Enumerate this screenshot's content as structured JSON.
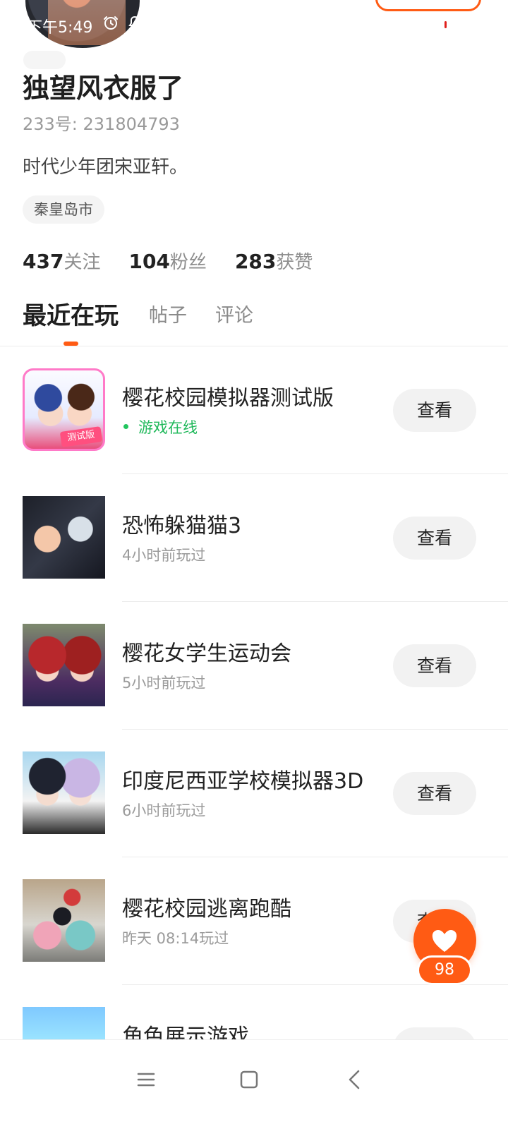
{
  "status_bar": {
    "time": "下午5:49",
    "icons": [
      "alarm-icon",
      "app-notification-icon"
    ]
  },
  "profile": {
    "username": "独望风衣服了",
    "id_text": "233号: 231804793",
    "bio": "时代少年团宋亚轩。",
    "location": "秦皇岛市",
    "stats": [
      {
        "value": "437",
        "label": "关注"
      },
      {
        "value": "104",
        "label": "粉丝"
      },
      {
        "value": "283",
        "label": "获赞"
      }
    ]
  },
  "tabs": [
    {
      "label": "最近在玩",
      "active": true
    },
    {
      "label": "帖子",
      "active": false
    },
    {
      "label": "评论",
      "active": false
    }
  ],
  "games": [
    {
      "title": "樱花校园模拟器测试版",
      "subtitle": "游戏在线",
      "status": "online",
      "button": "查看",
      "icon": "sakura-school-test-icon",
      "badge": "测试版"
    },
    {
      "title": "恐怖躲猫猫3",
      "subtitle": "4小时前玩过",
      "status": "played",
      "button": "查看",
      "icon": "horror-hide-and-seek-icon"
    },
    {
      "title": "樱花女学生运动会",
      "subtitle": "5小时前玩过",
      "status": "played",
      "button": "查看",
      "icon": "sakura-girls-sports-icon"
    },
    {
      "title": "印度尼西亚学校模拟器3D",
      "subtitle": "6小时前玩过",
      "status": "played",
      "button": "查看",
      "icon": "indonesia-school-sim-icon"
    },
    {
      "title": "樱花校园逃离跑酷",
      "subtitle": "昨天 08:14玩过",
      "status": "played",
      "button": "查看",
      "icon": "sakura-escape-parkour-icon"
    },
    {
      "title": "角色展示游戏",
      "subtitle": "",
      "status": "partial",
      "button": "",
      "icon": "character-show-game-icon"
    }
  ],
  "like_button": {
    "count": "98",
    "icon": "heart-icon"
  },
  "navigation": {
    "icons": [
      "menu-icon",
      "home-icon",
      "back-icon"
    ]
  },
  "colors": {
    "accent": "#ff5b14",
    "online": "#1fb85a",
    "secondary_text": "#9b9b9b",
    "button_bg": "#f2f2f2"
  }
}
